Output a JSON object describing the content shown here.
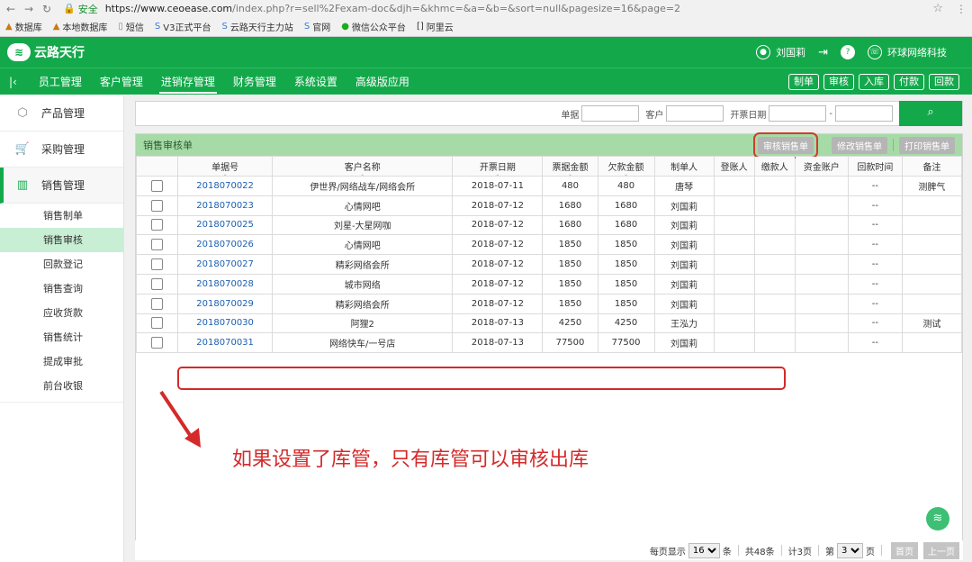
{
  "browser": {
    "secure_label": "安全",
    "url_host": "https://www.ceoease.com",
    "url_rest": "/index.php?r=sell%2Fexam-doc&djh=&khmc=&a=&b=&sort=null&pagesize=16&page=2",
    "bookmarks": [
      "数据库",
      "本地数据库",
      "短信",
      "V3正式平台",
      "云路天行主力站",
      "官网",
      "微信公众平台",
      "阿里云"
    ]
  },
  "app": {
    "logo_text": "云路天行",
    "user_name": "刘国莉",
    "company": "环球网络科技",
    "nav": [
      "员工管理",
      "客户管理",
      "进销存管理",
      "财务管理",
      "系统设置",
      "高级版应用"
    ],
    "active_nav": "进销存管理",
    "quick_buttons": [
      "制单",
      "审核",
      "入库",
      "付款",
      "回款"
    ]
  },
  "sidebar": {
    "cat_product": "产品管理",
    "cat_purchase": "采购管理",
    "cat_sales": "销售管理",
    "subs": [
      "销售制单",
      "销售审核",
      "回款登记",
      "销售查询",
      "应收货款",
      "销售统计",
      "提成审批",
      "前台收银"
    ],
    "active_sub": "销售审核"
  },
  "search": {
    "label_doc": "单据",
    "label_customer": "客户",
    "label_date": "开票日期",
    "date_dash": "-"
  },
  "panel": {
    "title": "销售审核单",
    "btn_audit": "审核销售单",
    "btn_edit": "修改销售单",
    "btn_print": "打印销售单"
  },
  "table": {
    "columns": [
      "",
      "单据号",
      "客户名称",
      "开票日期",
      "票据金额",
      "欠款金额",
      "制单人",
      "登账人",
      "缴款人",
      "资金账户",
      "回款时间",
      "备注"
    ],
    "rows": [
      [
        "2018070022",
        "伊世界/网络战车/网络会所",
        "2018-07-11",
        "480",
        "480",
        "唐琴",
        "",
        "",
        "",
        "--",
        "测脾气"
      ],
      [
        "2018070023",
        "心情网吧",
        "2018-07-12",
        "1680",
        "1680",
        "刘国莉",
        "",
        "",
        "",
        "--",
        ""
      ],
      [
        "2018070025",
        "刘星-大星网咖",
        "2018-07-12",
        "1680",
        "1680",
        "刘国莉",
        "",
        "",
        "",
        "--",
        ""
      ],
      [
        "2018070026",
        "心情网吧",
        "2018-07-12",
        "1850",
        "1850",
        "刘国莉",
        "",
        "",
        "",
        "--",
        ""
      ],
      [
        "2018070027",
        "精彩网络会所",
        "2018-07-12",
        "1850",
        "1850",
        "刘国莉",
        "",
        "",
        "",
        "--",
        ""
      ],
      [
        "2018070028",
        "城市网络",
        "2018-07-12",
        "1850",
        "1850",
        "刘国莉",
        "",
        "",
        "",
        "--",
        ""
      ],
      [
        "2018070029",
        "精彩网络会所",
        "2018-07-12",
        "1850",
        "1850",
        "刘国莉",
        "",
        "",
        "",
        "--",
        ""
      ],
      [
        "2018070030",
        "阿狸2",
        "2018-07-13",
        "4250",
        "4250",
        "王泓力",
        "",
        "",
        "",
        "--",
        "测试"
      ],
      [
        "2018070031",
        "网络快车/一号店",
        "2018-07-13",
        "77500",
        "77500",
        "刘国莉",
        "",
        "",
        "",
        "--",
        ""
      ]
    ]
  },
  "annotation": {
    "notice": "如果设置了库管，只有库管可以审核出库"
  },
  "pager": {
    "per_page_label": "每页显示",
    "per_page": "16",
    "unit": "条",
    "total": "共48条",
    "pages": "计3页",
    "page_prefix": "第",
    "page": "3",
    "page_suffix": "页",
    "first": "首页",
    "prev": "上一页"
  },
  "colors": {
    "brand_green": "#13a94b",
    "panel_header": "#a6dba7",
    "annotation_red": "#d42a2a",
    "link_blue": "#1b5fb0"
  }
}
